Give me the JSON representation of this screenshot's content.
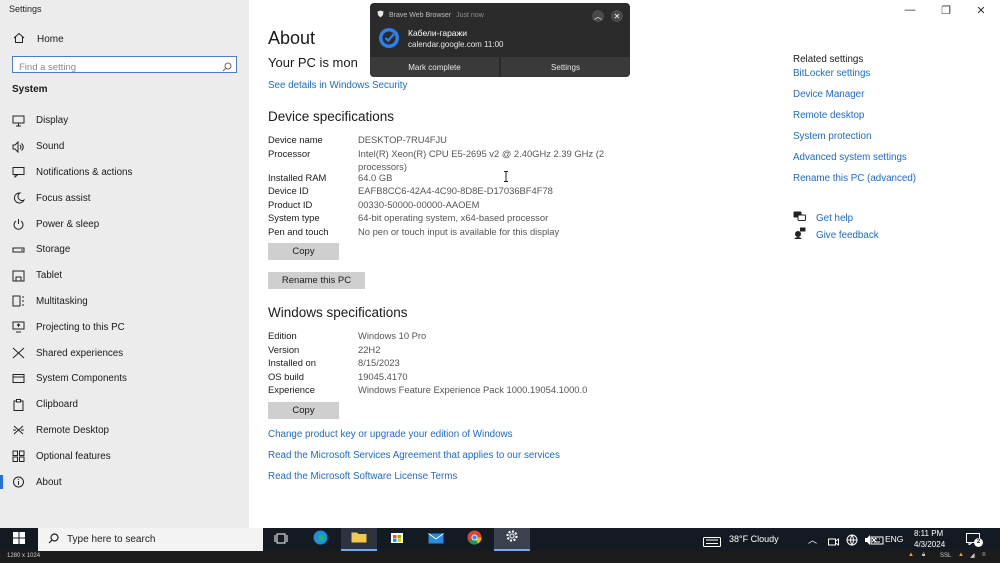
{
  "window": {
    "title": "Settings",
    "min": "—",
    "max": "❐",
    "close": "✕"
  },
  "sidebar": {
    "home": "Home",
    "search_placeholder": "Find a setting",
    "section": "System",
    "items": [
      {
        "label": "Display",
        "icon": "display-icon"
      },
      {
        "label": "Sound",
        "icon": "sound-icon"
      },
      {
        "label": "Notifications & actions",
        "icon": "notifications-icon"
      },
      {
        "label": "Focus assist",
        "icon": "focus-assist-icon"
      },
      {
        "label": "Power & sleep",
        "icon": "power-icon"
      },
      {
        "label": "Storage",
        "icon": "storage-icon"
      },
      {
        "label": "Tablet",
        "icon": "tablet-icon"
      },
      {
        "label": "Multitasking",
        "icon": "multitasking-icon"
      },
      {
        "label": "Projecting to this PC",
        "icon": "projecting-icon"
      },
      {
        "label": "Shared experiences",
        "icon": "shared-icon"
      },
      {
        "label": "System Components",
        "icon": "components-icon"
      },
      {
        "label": "Clipboard",
        "icon": "clipboard-icon"
      },
      {
        "label": "Remote Desktop",
        "icon": "remote-desktop-icon"
      },
      {
        "label": "Optional features",
        "icon": "optional-features-icon"
      },
      {
        "label": "About",
        "icon": "about-icon"
      }
    ]
  },
  "main": {
    "title": "About",
    "pc_status": "Your PC is mon",
    "security_link": "See details in Windows Security",
    "device_heading": "Device specifications",
    "device_specs": [
      {
        "k": "Device name",
        "v": "DESKTOP-7RU4FJU"
      },
      {
        "k": "Processor",
        "v": "Intel(R) Xeon(R) CPU E5-2695 v2 @ 2.40GHz   2.39 GHz  (2 processors)"
      },
      {
        "k": "Installed RAM",
        "v": "64.0 GB"
      },
      {
        "k": "Device ID",
        "v": "EAFB8CC6-42A4-4C90-8D8E-D17036BF4F78"
      },
      {
        "k": "Product ID",
        "v": "00330-50000-00000-AAOEM"
      },
      {
        "k": "System type",
        "v": "64-bit operating system, x64-based processor"
      },
      {
        "k": "Pen and touch",
        "v": "No pen or touch input is available for this display"
      }
    ],
    "copy_label": "Copy",
    "rename_label": "Rename this PC",
    "windows_heading": "Windows specifications",
    "windows_specs": [
      {
        "k": "Edition",
        "v": "Windows 10 Pro"
      },
      {
        "k": "Version",
        "v": "22H2"
      },
      {
        "k": "Installed on",
        "v": "8/15/2023"
      },
      {
        "k": "OS build",
        "v": "19045.4170"
      },
      {
        "k": "Experience",
        "v": "Windows Feature Experience Pack 1000.19054.1000.0"
      }
    ],
    "copy2_label": "Copy",
    "links": [
      "Change product key or upgrade your edition of Windows",
      "Read the Microsoft Services Agreement that applies to our services",
      "Read the Microsoft Software License Terms"
    ],
    "related_title": "Related settings",
    "related": [
      "BitLocker settings",
      "Device Manager",
      "Remote desktop",
      "System protection",
      "Advanced system settings",
      "Rename this PC (advanced)"
    ],
    "get_help": "Get help",
    "give_feedback": "Give feedback"
  },
  "toast": {
    "app": "Brave Web Browser",
    "time": "Just now",
    "title": "Кабели-гаражи",
    "body": "calendar.google.com 11:00",
    "action1": "Mark complete",
    "action2": "Settings"
  },
  "taskbar": {
    "search_placeholder": "Type here to search",
    "weather": "38°F  Cloudy",
    "lang": "ENG",
    "time": "8:11 PM",
    "date": "4/3/2024",
    "notif_count": "2"
  },
  "statusbar": {
    "left": "1280 x 1024",
    "right": "SSL"
  },
  "colors": {
    "accent": "#1f6bc4",
    "sidebar": "#ececec",
    "taskbar": "#141a22"
  }
}
